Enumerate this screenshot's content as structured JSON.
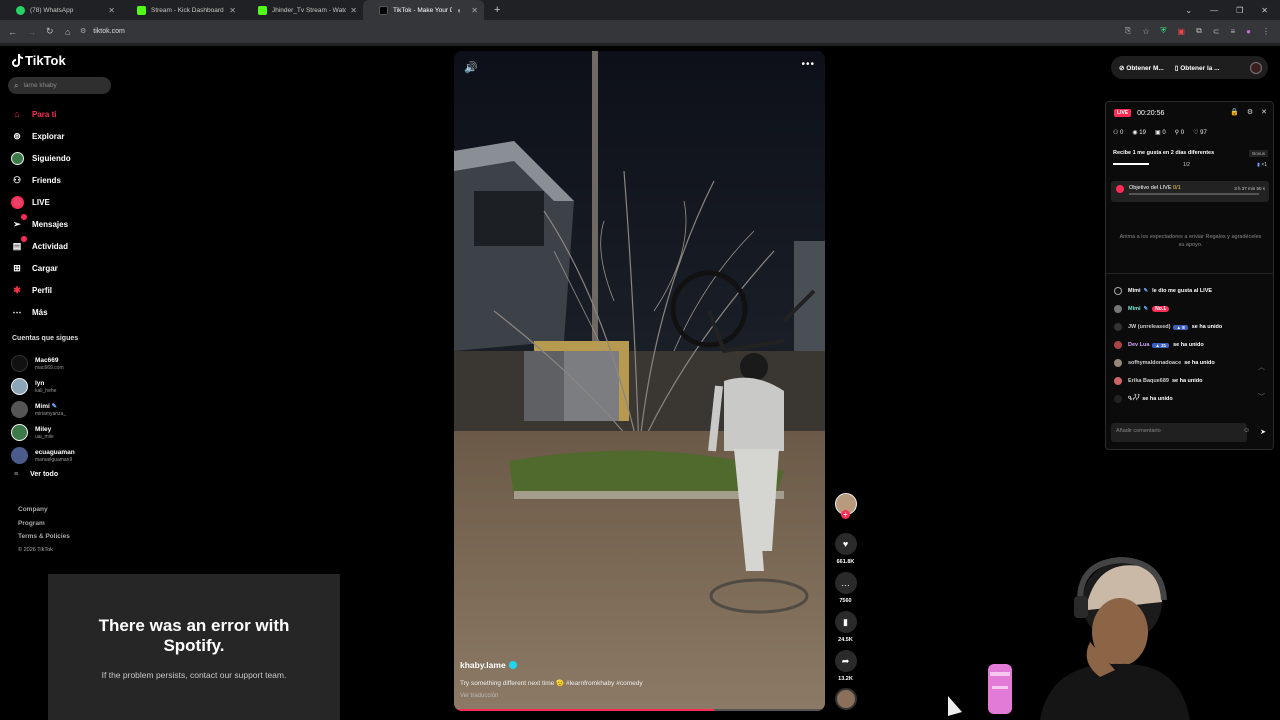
{
  "browser": {
    "tabs": [
      {
        "title": "(78) WhatsApp",
        "color": "#25d366"
      },
      {
        "title": "Stream - Kick Dashboard",
        "color": "#53fc18"
      },
      {
        "title": "Jhinder_Tv Stream - Watch Live",
        "color": "#53fc18"
      },
      {
        "title": "TikTok - Make Your Day",
        "color": "#000000"
      }
    ],
    "url": "tiktok.com"
  },
  "sidebar": {
    "brand": "TikTok",
    "search_placeholder": "lame khaby",
    "nav": [
      {
        "label": "Para ti",
        "icon": "home-icon"
      },
      {
        "label": "Explorar",
        "icon": "compass-icon"
      },
      {
        "label": "Siguiendo",
        "icon": "following-icon"
      },
      {
        "label": "Friends",
        "icon": "friends-icon"
      },
      {
        "label": "LIVE",
        "icon": "live-icon"
      },
      {
        "label": "Mensajes",
        "icon": "messages-icon"
      },
      {
        "label": "Actividad",
        "icon": "activity-icon"
      },
      {
        "label": "Cargar",
        "icon": "upload-icon"
      },
      {
        "label": "Perfil",
        "icon": "profile-icon"
      },
      {
        "label": "Más",
        "icon": "more-icon"
      }
    ],
    "following_title": "Cuentas que sigues",
    "following": [
      {
        "name": "Mac669",
        "handle": "mac669.com"
      },
      {
        "name": "lyn",
        "handle": "kali_hehe"
      },
      {
        "name": "Mimi",
        "handle": "miriamyanza_"
      },
      {
        "name": "Miley",
        "handle": "uai_mile"
      },
      {
        "name": "ecuaguaman",
        "handle": "manuelguaman9"
      }
    ],
    "see_all": "Ver todo",
    "footer": [
      "Company",
      "Program",
      "Terms & Policies"
    ],
    "copyright": "© 2026 TikTok"
  },
  "spotify_error": {
    "title": "There was an error with Spotify.",
    "message": "If the problem persists, contact our support team."
  },
  "video": {
    "author": "khaby.lame",
    "caption": "Try something different next time 🫡 #learnfromkhaby #comedy",
    "translate": "Ver traducción",
    "progress": 0.7
  },
  "actions": {
    "likes": "661.8K",
    "comments": "7560",
    "saves": "24.5K",
    "shares": "13.2K"
  },
  "top_buttons": [
    "Obtener M...",
    "Obtener la ..."
  ],
  "live_panel": {
    "badge": "LIVE",
    "timer": "00:20:56",
    "stats": [
      "0",
      "19",
      "0",
      "0",
      "97"
    ],
    "goal_text": "Recibe 1 me gusta en 2 días diferentes",
    "goal_progress": "1/2",
    "bonus": "Bonus",
    "bonus_count": "×1",
    "objective": "Objetivo del LIVE",
    "objective_count": "0/1",
    "objective_time": "3 h 37 min 50 s",
    "encourage": "Anima a los espectadores a enviar Regalos y agradéceles su apoyo.",
    "chat": [
      {
        "name": "Mimi",
        "msg": "le dio me gusta al LIVE",
        "color": "#ffffff"
      },
      {
        "name": "Mimi",
        "msg": "No.1",
        "color": "#7be7d6"
      },
      {
        "name": "JW (unreleased)",
        "msg": "se ha unido",
        "color": "#cccccc"
      },
      {
        "name": "Dev Lua",
        "msg": "se ha unido",
        "color": "#d6a4ff"
      },
      {
        "name": "sofhymaldonadoace",
        "msg": "se ha unido",
        "color": "#cccccc"
      },
      {
        "name": "Erika Baque689",
        "msg": "se ha unido",
        "color": "#cccccc"
      },
      {
        "name": "ᕴᓮᓮ",
        "msg": "se ha unido",
        "color": "#cccccc"
      }
    ],
    "comment_placeholder": "Añadir comentario"
  }
}
